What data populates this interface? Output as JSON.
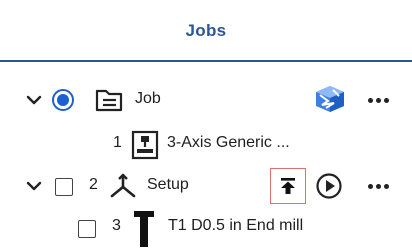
{
  "header": {
    "title": "Jobs"
  },
  "tree": [
    {
      "label": "Job",
      "icons": [
        "chevron-down-icon",
        "radio-selected",
        "folder-document-icon",
        "stock-model-icon",
        "more-icon"
      ]
    },
    {
      "number": "1",
      "label": "3-Axis Generic ...",
      "icons": [
        "machine-icon"
      ]
    },
    {
      "number": "2",
      "label": "Setup",
      "icons": [
        "chevron-down-icon",
        "checkbox-unchecked",
        "axes-icon",
        "post-process-icon",
        "play-icon",
        "more-icon"
      ]
    },
    {
      "number": "3",
      "label": "T1 D0.5 in End mill",
      "icons": [
        "checkbox-unchecked",
        "end-mill-tool-icon"
      ]
    }
  ]
}
